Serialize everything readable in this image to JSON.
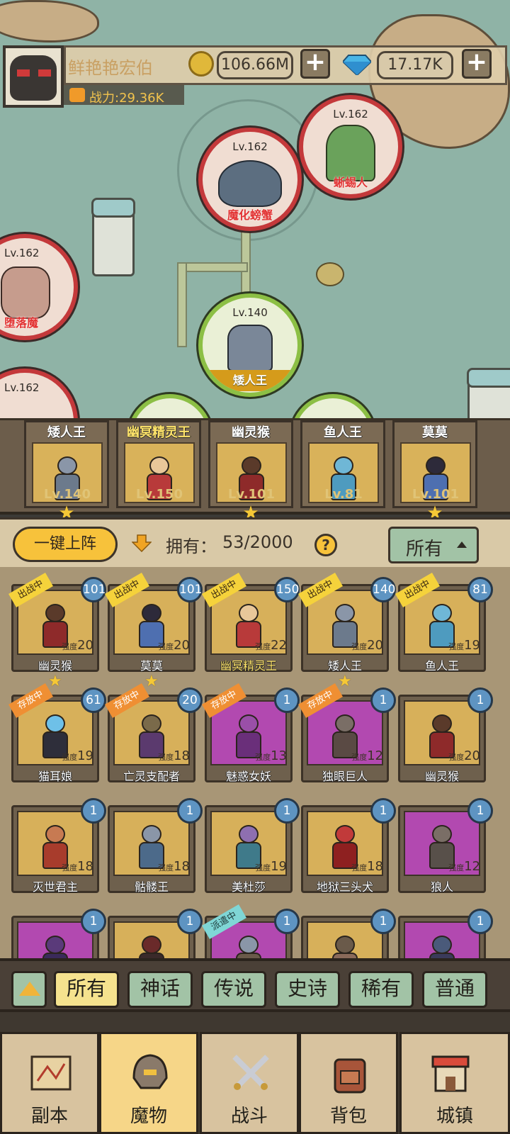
{
  "player": {
    "name": "鲜艳艳宏伯",
    "power": "战力:29.36K"
  },
  "resources": {
    "coins": "106.66M",
    "gems": "17.17K",
    "plus": "+"
  },
  "map_nodes": [
    {
      "level": "Lv.162",
      "name": "蜥蜴人"
    },
    {
      "level": "Lv.162",
      "name": "魔化螃蟹"
    },
    {
      "level": "Lv.162",
      "name": "堕落魔"
    },
    {
      "level": "Lv.140",
      "name": "矮人王"
    },
    {
      "level": "Lv.162",
      "name": ""
    }
  ],
  "team": [
    {
      "name": "矮人王",
      "level": "Lv.140",
      "mythic": false
    },
    {
      "name": "幽冥精灵王",
      "level": "Lv.150",
      "mythic": true
    },
    {
      "name": "幽灵猴",
      "level": "Lv.101",
      "mythic": false
    },
    {
      "name": "鱼人王",
      "level": "Lv.81",
      "mythic": false
    },
    {
      "name": "莫莫",
      "level": "Lv.101",
      "mythic": false
    }
  ],
  "team_stars": [
    "★",
    "★",
    "★"
  ],
  "controls": {
    "one_click": "一键上阵",
    "own_label": "拥有：",
    "own_count": "53/2000",
    "help": "?",
    "filter": "所有"
  },
  "strength_label": "强度",
  "tags": {
    "fight": "出战中",
    "store": "存放中",
    "dispatch": "派遣中"
  },
  "monsters": [
    {
      "name": "幽灵猴",
      "level": "101",
      "strength": "20",
      "tag": "fight",
      "bg": "gold",
      "star": "★"
    },
    {
      "name": "莫莫",
      "level": "101",
      "strength": "20",
      "tag": "fight",
      "bg": "gold",
      "star": "★"
    },
    {
      "name": "幽冥精灵王",
      "level": "150",
      "strength": "22",
      "tag": "fight",
      "bg": "gold",
      "mythic": true
    },
    {
      "name": "矮人王",
      "level": "140",
      "strength": "20",
      "tag": "fight",
      "bg": "gold",
      "star": "★"
    },
    {
      "name": "鱼人王",
      "level": "81",
      "strength": "19",
      "tag": "fight",
      "bg": "gold"
    },
    {
      "name": "猫耳娘",
      "level": "61",
      "strength": "19",
      "tag": "store",
      "bg": "gold"
    },
    {
      "name": "亡灵支配者",
      "level": "20",
      "strength": "18",
      "tag": "store",
      "bg": "gold"
    },
    {
      "name": "魅惑女妖",
      "level": "1",
      "strength": "13",
      "tag": "store",
      "bg": "purple"
    },
    {
      "name": "独眼巨人",
      "level": "1",
      "strength": "12",
      "tag": "store",
      "bg": "purple"
    },
    {
      "name": "幽灵猴",
      "level": "1",
      "strength": "20",
      "bg": "gold"
    },
    {
      "name": "灭世君主",
      "level": "1",
      "strength": "18",
      "bg": "gold"
    },
    {
      "name": "骷髅王",
      "level": "1",
      "strength": "18",
      "bg": "gold"
    },
    {
      "name": "美杜莎",
      "level": "1",
      "strength": "19",
      "bg": "gold"
    },
    {
      "name": "地狱三头犬",
      "level": "1",
      "strength": "18",
      "bg": "gold"
    },
    {
      "name": "狼人",
      "level": "1",
      "strength": "12",
      "bg": "purple"
    },
    {
      "level": "1",
      "bg": "purple"
    },
    {
      "level": "1",
      "bg": "gold"
    },
    {
      "level": "1",
      "tag": "dispatch",
      "bg": "purple"
    },
    {
      "level": "1",
      "bg": "gold"
    },
    {
      "level": "1",
      "bg": "purple"
    }
  ],
  "rarity_tabs": [
    "所有",
    "神话",
    "传说",
    "史诗",
    "稀有",
    "普通"
  ],
  "nav": [
    "副本",
    "魔物",
    "战斗",
    "背包",
    "城镇"
  ],
  "colors": {
    "accent": "#f7c23b",
    "gold_card": "#d7b05a",
    "purple_card": "#b249b0",
    "tab_green": "#a2c3a6",
    "level_badge": "#5e94c2"
  }
}
